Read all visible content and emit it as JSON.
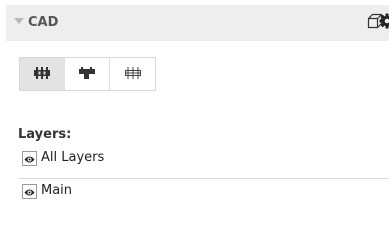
{
  "panel": {
    "title": "CAD",
    "icons": [
      "cube-icon",
      "gear-icon"
    ]
  },
  "view_modes": [
    {
      "icon": "assembly-icon",
      "active": true
    },
    {
      "icon": "part-icon",
      "active": false
    },
    {
      "icon": "wireframe-icon",
      "active": false
    }
  ],
  "layers": {
    "label": "Layers:",
    "items": [
      {
        "name": "All Layers",
        "visible": true
      },
      {
        "name": "Main",
        "visible": true
      }
    ]
  },
  "colors": {
    "header_bg": "#eeeeee",
    "active_segment_bg": "#e3e3e3"
  }
}
